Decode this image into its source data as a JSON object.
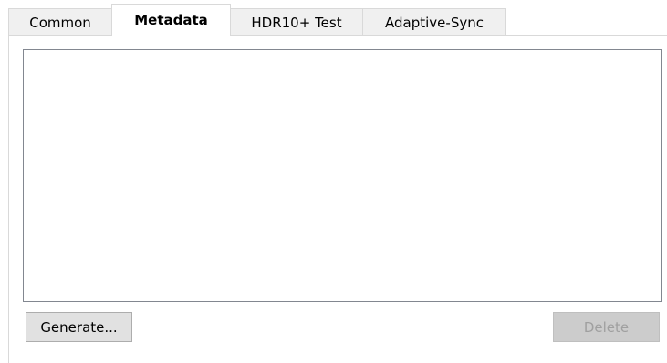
{
  "tabs": [
    {
      "label": "Common",
      "active": false
    },
    {
      "label": "Metadata",
      "active": true
    },
    {
      "label": "HDR10+ Test",
      "active": false
    },
    {
      "label": "Adaptive-Sync",
      "active": false
    }
  ],
  "metadata_tab": {
    "list_items": [],
    "generate_label": "Generate...",
    "delete_label": "Delete",
    "delete_enabled": false
  }
}
